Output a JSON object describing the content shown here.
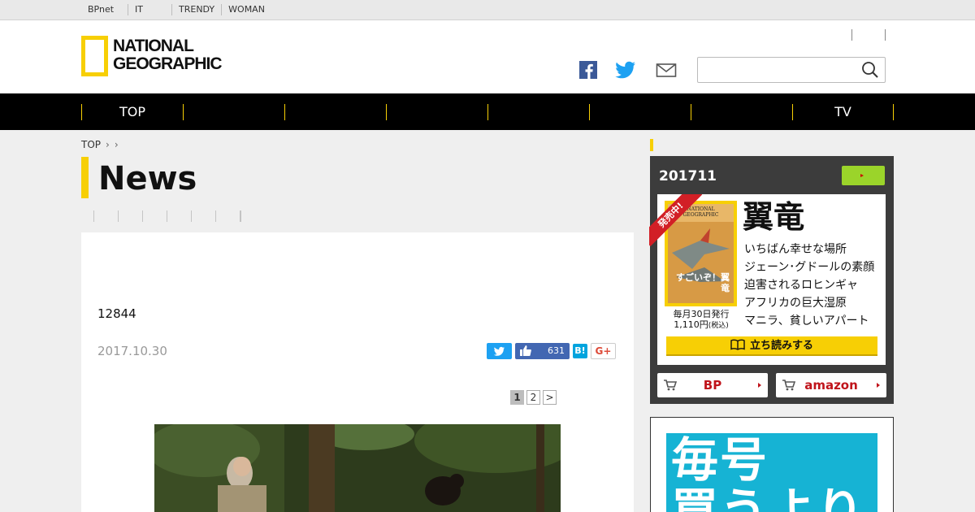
{
  "util_bar": {
    "items": [
      "BPnet",
      "",
      "IT",
      "",
      "",
      "",
      "TRENDY",
      "WOMAN",
      "",
      "",
      ""
    ]
  },
  "header": {
    "logo_line1": "NATIONAL",
    "logo_line2": "GEOGRAPHIC",
    "search_placeholder": "",
    "icons": [
      "facebook-icon",
      "twitter-icon",
      "mail-icon",
      "search-icon"
    ]
  },
  "nav": {
    "items": [
      "TOP",
      "",
      "",
      "",
      "",
      "",
      "",
      "TV"
    ]
  },
  "breadcrumb": {
    "home": "TOP"
  },
  "section": {
    "title": "News"
  },
  "article": {
    "title": "12844",
    "date": "2017.10.30",
    "like_count": "631",
    "hatena_label": "B!",
    "gplus_label": "G+",
    "pages": [
      "1",
      "2",
      ">"
    ],
    "current_page": "1"
  },
  "sidebar": {
    "magazine": {
      "issue": "201711",
      "ribbon": "発売中!",
      "cover_caption": "すごいぞ！翼竜",
      "cover_brand": "NATIONAL GEOGRAPHIC",
      "headline": "翼竜",
      "contents": [
        "いちばん幸せな場所",
        "ジェーン･グドールの素顔",
        "迫害されるロヒンギャ",
        "アフリカの巨大湿原",
        "マニラ、貧しいアパート"
      ],
      "pub_line1": "毎月30日発行",
      "pub_line2": "1,110円",
      "pub_tax": "(税込)",
      "read_label": "立ち読みする",
      "buy_bp": "BP",
      "buy_amazon": "amazon"
    },
    "promo": {
      "text": "毎号\n買うより"
    }
  },
  "colors": {
    "accent_yellow": "#f7cf05",
    "nav_bg": "#000000",
    "twitter_blue": "#1da1f2",
    "facebook_blue": "#4267b2",
    "buy_red": "#c0141b",
    "promo_blue": "#16b3d4"
  }
}
